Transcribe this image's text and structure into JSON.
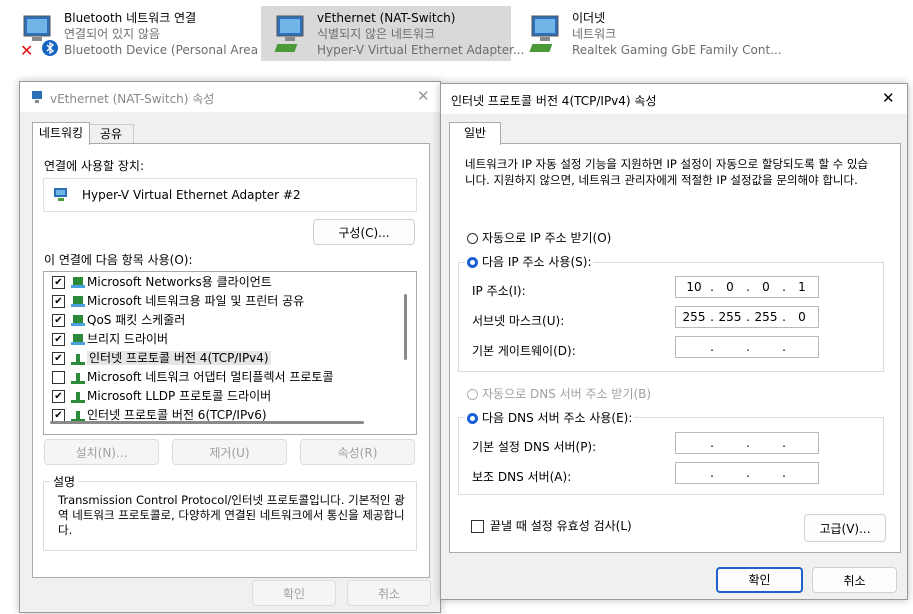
{
  "adapters": [
    {
      "name": "Bluetooth 네트워크 연결",
      "status": "연결되어 있지 않음",
      "device": "Bluetooth Device (Personal Area ..."
    },
    {
      "name": "vEthernet (NAT-Switch)",
      "status": "식별되지 않은 네트워크",
      "device": "Hyper-V Virtual Ethernet Adapter..."
    },
    {
      "name": "이더넷",
      "status": "네트워크",
      "device": "Realtek Gaming GbE Family Cont..."
    }
  ],
  "props": {
    "title": "vEthernet (NAT-Switch) 속성",
    "tabs": [
      "네트워킹",
      "공유"
    ],
    "connect_using_label": "연결에 사용할 장치:",
    "device_name": "Hyper-V Virtual Ethernet Adapter #2",
    "configure_label": "구성(C)...",
    "items_label": "이 연결에 다음 항목 사용(O):",
    "items": [
      {
        "label": "Microsoft Networks용 클라이언트",
        "checked": true
      },
      {
        "label": "Microsoft 네트워크용 파일 및 프린터 공유",
        "checked": true
      },
      {
        "label": "QoS 패킷 스케줄러",
        "checked": true
      },
      {
        "label": "브리지 드라이버",
        "checked": true
      },
      {
        "label": "인터넷 프로토콜 버전 4(TCP/IPv4)",
        "checked": true
      },
      {
        "label": "Microsoft 네트워크 어댑터 멀티플렉서 프로토콜",
        "checked": false
      },
      {
        "label": "Microsoft LLDP 프로토콜 드라이버",
        "checked": true
      },
      {
        "label": "인터넷 프로토콜 버전 6(TCP/IPv6)",
        "checked": true
      }
    ],
    "install_label": "설치(N)...",
    "remove_label": "제거(U)",
    "properties_label": "속성(R)",
    "description_title": "설명",
    "description": "Transmission Control Protocol/인터넷 프로토콜입니다. 기본적인 광역 네트워크 프로토콜로, 다양하게 연결된 네트워크에서 통신을 제공합니다.",
    "ok_label": "확인",
    "cancel_label": "취소"
  },
  "ipv4": {
    "title": "인터넷 프로토콜 버전 4(TCP/IPv4) 속성",
    "tab": "일반",
    "intro": "네트워크가 IP 자동 설정 기능을 지원하면 IP 설정이 자동으로 할당되도록 할 수 있습니다. 지원하지 않으면, 네트워크 관리자에게 적절한 IP 설정값을 문의해야 합니다.",
    "auto_ip_label": "자동으로 IP 주소 받기(O)",
    "manual_ip_label": "다음 IP 주소 사용(S):",
    "ip_label": "IP 주소(I):",
    "ip_value": [
      "10",
      "0",
      "0",
      "1"
    ],
    "mask_label": "서브넷 마스크(U):",
    "mask_value": [
      "255",
      "255",
      "255",
      "0"
    ],
    "gateway_label": "기본 게이트웨이(D):",
    "auto_dns_label": "자동으로 DNS 서버 주소 받기(B)",
    "manual_dns_label": "다음 DNS 서버 주소 사용(E):",
    "pref_dns_label": "기본 설정 DNS 서버(P):",
    "alt_dns_label": "보조 DNS 서버(A):",
    "validate_label": "끝낼 때 설정 유효성 검사(L)",
    "advanced_label": "고급(V)...",
    "ok_label": "확인",
    "cancel_label": "취소"
  }
}
